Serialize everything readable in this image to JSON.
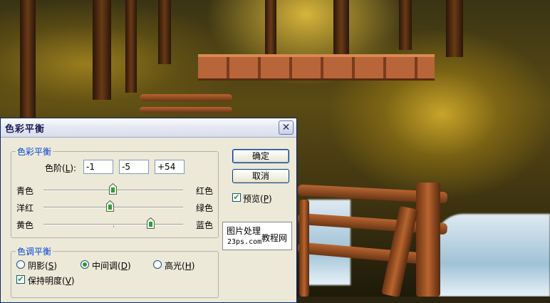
{
  "dialog": {
    "title": "色彩平衡",
    "close_glyph": "✕",
    "color_balance": {
      "legend": "色彩平衡",
      "levels_label": "色阶(",
      "levels_key": "L",
      "levels_suffix": "):",
      "levels": [
        "-1",
        "-5",
        "+54"
      ],
      "sliders": [
        {
          "left": "青色",
          "right": "红色",
          "value": -1
        },
        {
          "left": "洋红",
          "right": "绿色",
          "value": -5
        },
        {
          "left": "黄色",
          "right": "蓝色",
          "value": 54
        }
      ],
      "slider_range": [
        -100,
        100
      ]
    },
    "tone_balance": {
      "legend": "色调平衡",
      "options": [
        {
          "label": "阴影",
          "key": "S",
          "selected": false
        },
        {
          "label": "中间调",
          "key": "D",
          "selected": true
        },
        {
          "label": "高光",
          "key": "H",
          "selected": false
        }
      ],
      "preserve_luminosity": {
        "label": "保持明度",
        "key": "V",
        "checked": true
      }
    },
    "buttons": {
      "ok": "确定",
      "cancel": "取消"
    },
    "preview": {
      "label": "预览",
      "key": "P",
      "checked": true
    }
  },
  "watermark": {
    "line1": "图片处理",
    "line2": "教程网",
    "line3": "23ps.com"
  },
  "colors": {
    "accent_green": "#21a121",
    "legend_blue": "#0046d5",
    "dialog_bg": "#ece9d8"
  }
}
